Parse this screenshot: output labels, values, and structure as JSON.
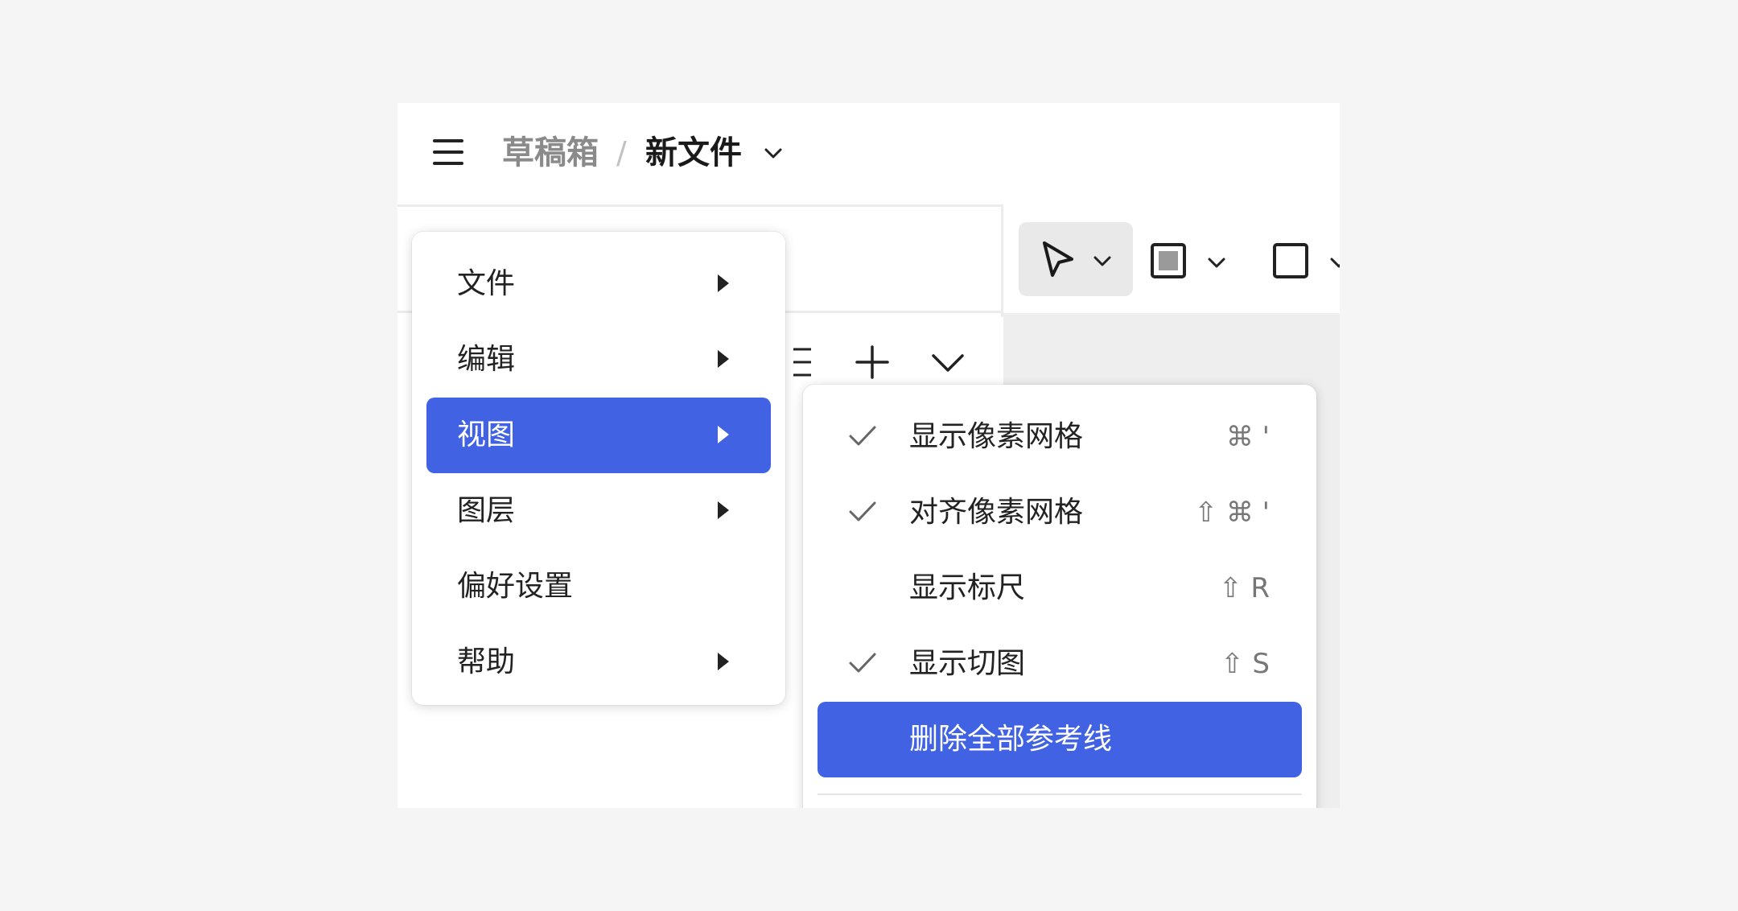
{
  "header": {
    "breadcrumb_parent": "草稿箱",
    "breadcrumb_separator": "/",
    "breadcrumb_current": "新文件"
  },
  "toolbar": {
    "tools": [
      {
        "name": "move-tool",
        "icon": "cursor-arrow-icon",
        "active": true
      },
      {
        "name": "frame-tool",
        "icon": "frame-icon",
        "active": false
      },
      {
        "name": "rectangle-tool",
        "icon": "square-icon",
        "active": false
      }
    ]
  },
  "menu": {
    "items": [
      {
        "label": "文件",
        "has_submenu": true,
        "active": false
      },
      {
        "label": "编辑",
        "has_submenu": true,
        "active": false
      },
      {
        "label": "视图",
        "has_submenu": true,
        "active": true
      },
      {
        "label": "图层",
        "has_submenu": true,
        "active": false
      },
      {
        "label": "偏好设置",
        "has_submenu": false,
        "active": false
      },
      {
        "label": "帮助",
        "has_submenu": true,
        "active": false
      }
    ]
  },
  "submenu": {
    "items": [
      {
        "label": "显示像素网格",
        "checked": true,
        "shortcut": "⌘ '"
      },
      {
        "label": "对齐像素网格",
        "checked": true,
        "shortcut": "⇧ ⌘ '"
      },
      {
        "label": "显示标尺",
        "checked": false,
        "shortcut": "⇧ R"
      },
      {
        "label": "显示切图",
        "checked": true,
        "shortcut": "⇧ S"
      },
      {
        "label": "删除全部参考线",
        "checked": false,
        "shortcut": "",
        "active": true
      }
    ]
  },
  "colors": {
    "accent": "#4162e3",
    "background": "#f5f5f5",
    "canvas": "#eeeeee"
  }
}
